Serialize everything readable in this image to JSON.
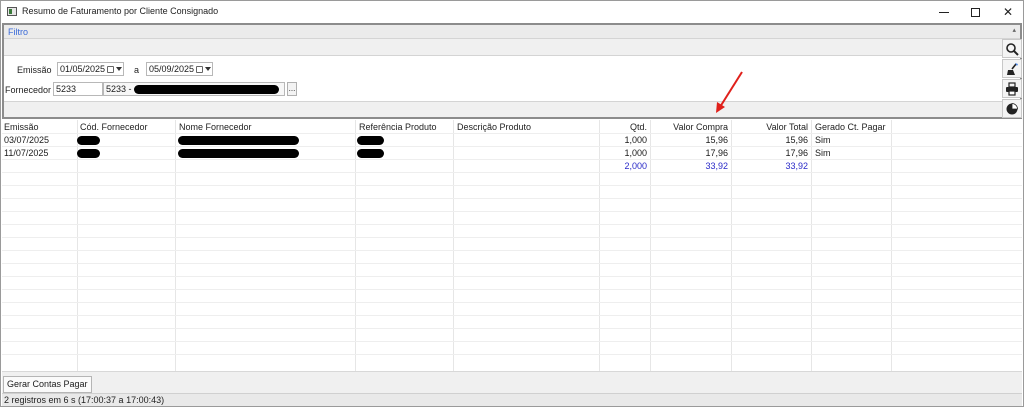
{
  "window": {
    "title": "Resumo de Faturamento por Cliente Consignado",
    "controls": {
      "minimize": "—",
      "maximize": "☐",
      "close": "✕"
    }
  },
  "filter": {
    "header_label": "Filtro",
    "pin_glyph": "▴",
    "emissao_label": "Emissão",
    "date_from": "01/05/2025",
    "date_sep": "a",
    "date_to": "05/09/2025",
    "fornecedor_label": "Fornecedor",
    "fornecedor_code": "5233",
    "fornecedor_name_prefix": "5233 -",
    "lookup_btn": "..."
  },
  "toolbar": {
    "icons": [
      "search-icon",
      "clear-filter-icon",
      "print-icon",
      "pie-chart-icon"
    ]
  },
  "grid": {
    "columns": [
      "Emissão",
      "Cód. Fornecedor",
      "Nome Fornecedor",
      "Referência Produto",
      "Descrição Produto",
      "Qtd.",
      "Valor Compra",
      "Valor Total",
      "Gerado Ct. Pagar"
    ],
    "rows": [
      {
        "emissao": "03/07/2025",
        "qtd": "1,000",
        "valor_compra": "15,96",
        "valor_total": "15,96",
        "gerado": "Sim"
      },
      {
        "emissao": "11/07/2025",
        "qtd": "1,000",
        "valor_compra": "17,96",
        "valor_total": "17,96",
        "gerado": "Sim"
      }
    ],
    "totals": {
      "qtd": "2,000",
      "valor_compra": "33,92",
      "valor_total": "33,92"
    }
  },
  "actions": {
    "gerar_contas_pagar": "Gerar Contas Pagar"
  },
  "status": {
    "text": "2 registros em 6 s (17:00:37 a 17:00:43)"
  },
  "colors": {
    "accent": "#3a6ad8",
    "totals": "#2a2ac8",
    "annotation_arrow": "#e0201b"
  }
}
